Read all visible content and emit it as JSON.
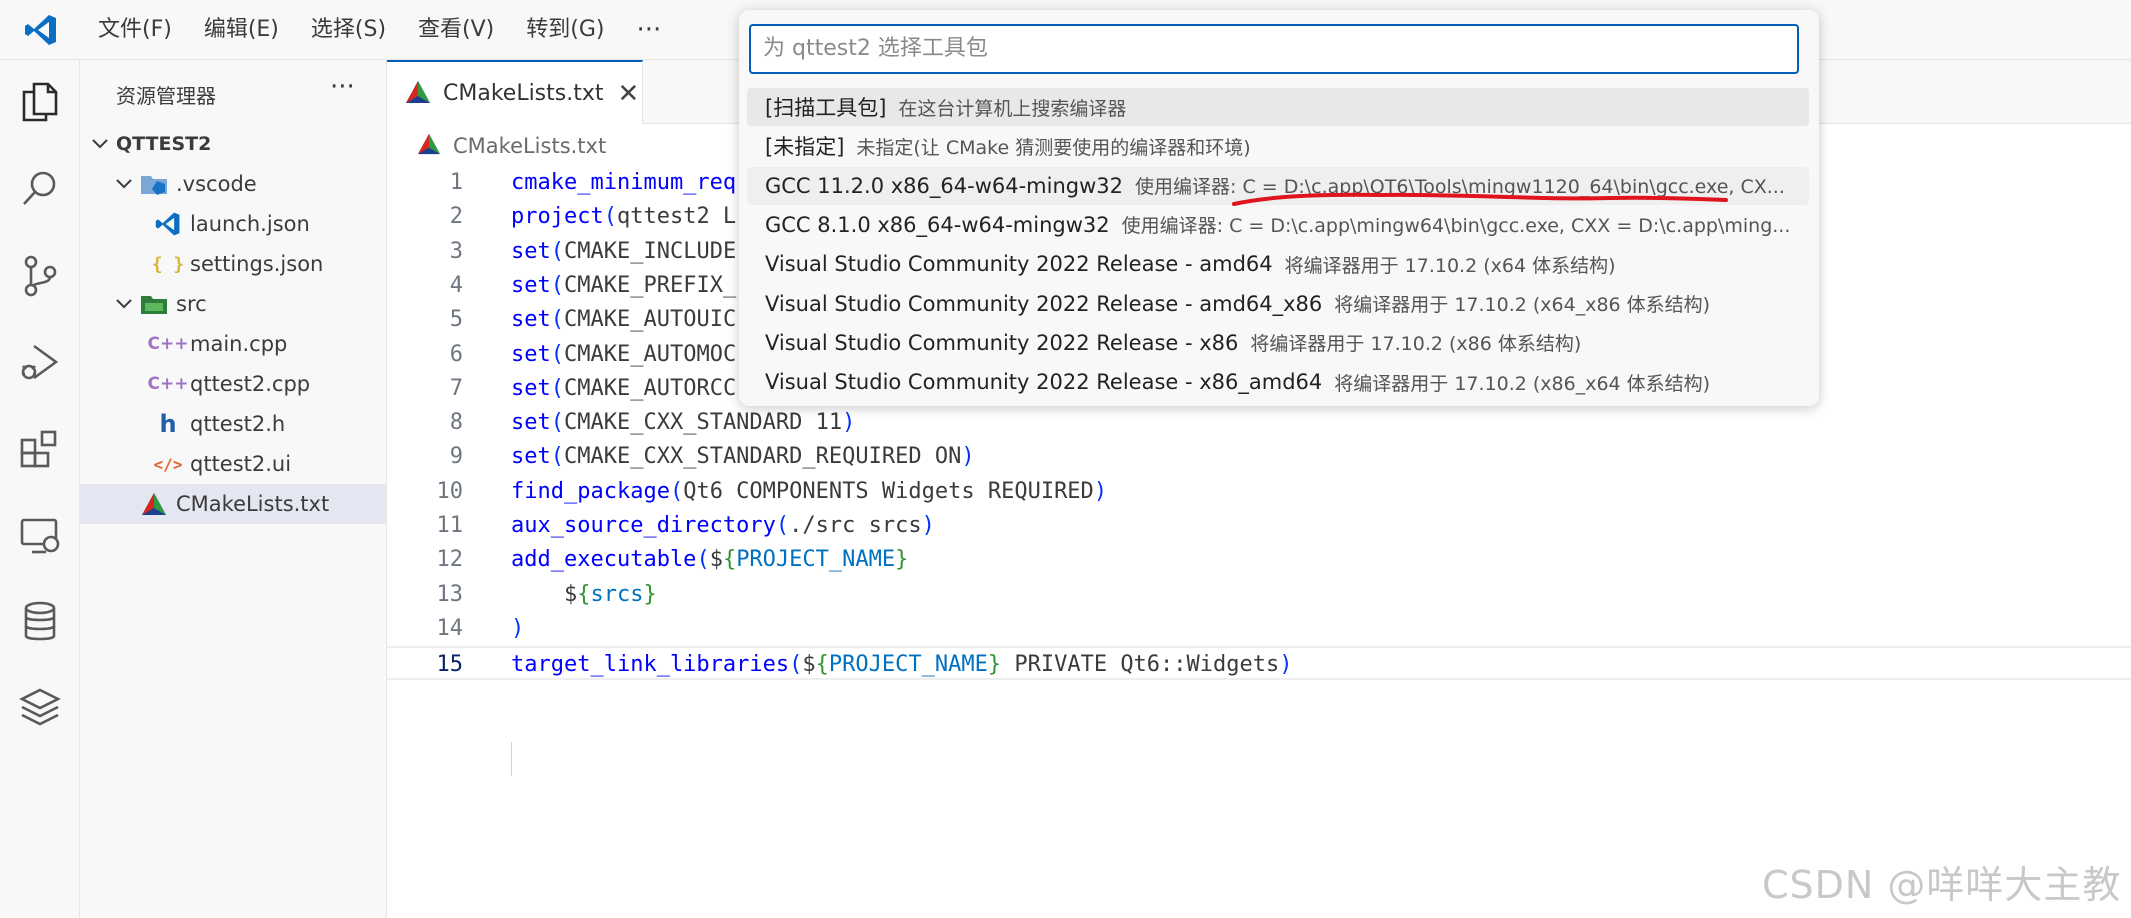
{
  "menu": [
    "文件(F)",
    "编辑(E)",
    "选择(S)",
    "查看(V)",
    "转到(G)"
  ],
  "menu_more": "···",
  "explorer": {
    "title": "资源管理器",
    "more": "···",
    "root": "QTTEST2",
    "items": [
      {
        "label": ".vscode"
      },
      {
        "label": "launch.json"
      },
      {
        "label": "settings.json"
      },
      {
        "label": "src"
      },
      {
        "label": "main.cpp"
      },
      {
        "label": "qttest2.cpp"
      },
      {
        "label": "qttest2.h"
      },
      {
        "label": "qttest2.ui"
      },
      {
        "label": "CMakeLists.txt"
      }
    ]
  },
  "tab": {
    "label": "CMakeLists.txt",
    "close": "✕"
  },
  "breadcrumb": "CMakeLists.txt",
  "code": {
    "lines": [
      {
        "n": "1",
        "parts": [
          [
            "fn",
            "cmake_minimum_req"
          ]
        ]
      },
      {
        "n": "2",
        "parts": [
          [
            "fn",
            "project"
          ],
          [
            "par",
            "("
          ],
          [
            "plain",
            "qttest2 L"
          ]
        ]
      },
      {
        "n": "3",
        "parts": [
          [
            "fn",
            "set"
          ],
          [
            "par",
            "("
          ],
          [
            "plain",
            "CMAKE_INCLUDE"
          ]
        ]
      },
      {
        "n": "4",
        "parts": [
          [
            "fn",
            "set"
          ],
          [
            "par",
            "("
          ],
          [
            "plain",
            "CMAKE_PREFIX_"
          ]
        ]
      },
      {
        "n": "5",
        "parts": [
          [
            "fn",
            "set"
          ],
          [
            "par",
            "("
          ],
          [
            "plain",
            "CMAKE_AUTOUIC"
          ]
        ]
      },
      {
        "n": "6",
        "parts": [
          [
            "fn",
            "set"
          ],
          [
            "par",
            "("
          ],
          [
            "plain",
            "CMAKE_AUTOMOC"
          ]
        ]
      },
      {
        "n": "7",
        "parts": [
          [
            "fn",
            "set"
          ],
          [
            "par",
            "("
          ],
          [
            "plain",
            "CMAKE_AUTORCC"
          ]
        ]
      },
      {
        "n": "8",
        "parts": [
          [
            "fn",
            "set"
          ],
          [
            "par",
            "("
          ],
          [
            "plain",
            "CMAKE_CXX_STANDARD 11"
          ],
          [
            "par",
            ")"
          ]
        ]
      },
      {
        "n": "9",
        "parts": [
          [
            "fn",
            "set"
          ],
          [
            "par",
            "("
          ],
          [
            "plain",
            "CMAKE_CXX_STANDARD_REQUIRED ON"
          ],
          [
            "par",
            ")"
          ]
        ]
      },
      {
        "n": "10",
        "parts": [
          [
            "fn",
            "find_package"
          ],
          [
            "par",
            "("
          ],
          [
            "plain",
            "Qt6 COMPONENTS Widgets REQUIRED"
          ],
          [
            "par",
            ")"
          ]
        ]
      },
      {
        "n": "11",
        "parts": [
          [
            "fn",
            "aux_source_directory"
          ],
          [
            "par",
            "("
          ],
          [
            "plain",
            "./src srcs"
          ],
          [
            "par",
            ")"
          ]
        ]
      },
      {
        "n": "12",
        "parts": [
          [
            "fn",
            "add_executable"
          ],
          [
            "par",
            "("
          ],
          [
            "plain",
            "$"
          ],
          [
            "brace",
            "{"
          ],
          [
            "var",
            "PROJECT_NAME"
          ],
          [
            "brace",
            "}"
          ]
        ]
      },
      {
        "n": "13",
        "parts": [
          [
            "plain",
            "    $"
          ],
          [
            "brace",
            "{"
          ],
          [
            "var",
            "srcs"
          ],
          [
            "brace",
            "}"
          ]
        ]
      },
      {
        "n": "14",
        "parts": [
          [
            "par",
            ")"
          ]
        ]
      },
      {
        "n": "15",
        "parts": [
          [
            "fn",
            "target_link_libraries"
          ],
          [
            "par",
            "("
          ],
          [
            "plain",
            "$"
          ],
          [
            "brace",
            "{"
          ],
          [
            "var",
            "PROJECT_NAME"
          ],
          [
            "brace",
            "}"
          ],
          [
            "plain",
            " PRIVATE Qt6::Widgets"
          ],
          [
            "par",
            ")"
          ]
        ]
      }
    ]
  },
  "quickpick": {
    "placeholder": "为 qttest2 选择工具包",
    "items": [
      {
        "label": "[扫描工具包]",
        "desc": "在这台计算机上搜索编译器"
      },
      {
        "label": "[未指定]",
        "desc": "未指定(让 CMake 猜测要使用的编译器和环境)"
      },
      {
        "label": "GCC 11.2.0 x86_64-w64-mingw32",
        "desc": "使用编译器: C = D:\\c.app\\QT6\\Tools\\mingw1120_64\\bin\\gcc.exe, CX..."
      },
      {
        "label": "GCC 8.1.0 x86_64-w64-mingw32",
        "desc": "使用编译器: C = D:\\c.app\\mingw64\\bin\\gcc.exe, CXX = D:\\c.app\\ming..."
      },
      {
        "label": "Visual Studio Community 2022 Release - amd64",
        "desc": "将编译器用于 17.10.2 (x64 体系结构)"
      },
      {
        "label": "Visual Studio Community 2022 Release - amd64_x86",
        "desc": "将编译器用于 17.10.2 (x64_x86 体系结构)"
      },
      {
        "label": "Visual Studio Community 2022 Release - x86",
        "desc": "将编译器用于 17.10.2 (x86 体系结构)"
      },
      {
        "label": "Visual Studio Community 2022 Release - x86_amd64",
        "desc": "将编译器用于 17.10.2 (x86_x64 体系结构)"
      }
    ]
  },
  "watermark": "CSDN @咩咩大主教",
  "colors": {
    "accent": "#005fb8",
    "annotation": "#e0141e"
  }
}
